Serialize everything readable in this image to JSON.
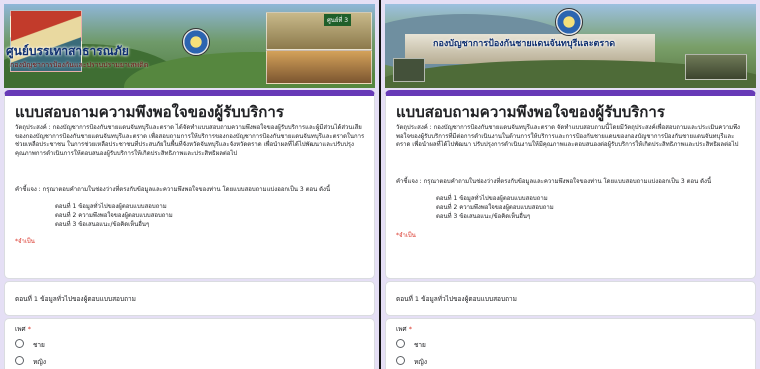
{
  "panels": [
    {
      "banner": {
        "title": "ศูนย์บรรเทาสาธารณภัย",
        "subtitle": "กองบัญชาการป้องกันและปราบปรามยาเสพติด",
        "tag": "ศูนย์ที่ 3"
      },
      "form": {
        "title": "แบบสอบถามความพึงพอใจของผู้รับบริการ",
        "objective": "วัตถุประสงค์ : กองบัญชาการป้องกันชายแดนจันทบุรีและตราด ได้จัดทำแบบสอบถามความพึงพอใจของผู้รับบริการและผู้มีส่วนได้ส่วนเสียของกองบัญชาการป้องกันชายแดนจันทบุรีและตราด เพื่อสอบถามการให้บริการของกองบัญชาการป้องกันชายแดนจันทบุรีและตราดในการช่วยเหลือประชาชน ในการช่วยเหลือประชาชนที่ประสบภัยในพื้นที่จังหวัดจันทบุรีและจังหวัดตราด เพื่อนำผลที่ได้ไปพัฒนาและปรับปรุงคุณภาพการดำเนินการให้ตอบสนองผู้รับบริการให้เกิดประสิทธิภาพและประสิทธิผลต่อไป",
        "explanation": "คำชี้แจง : กรุณาตอบคำถามในช่องว่างที่ตรงกับข้อมูลและความพึงพอใจของท่าน โดยแบบสอบถามแบ่งออกเป็น 3 ตอน ดังนี้",
        "parts": [
          "ตอนที่ 1 ข้อมูลทั่วไปของผู้ตอบแบบสอบถาม",
          "ตอนที่ 2 ความพึงพอใจของผู้ตอบแบบสอบถาม",
          "ตอนที่ 3 ข้อเสนอแนะ/ข้อคิดเห็นอื่นๆ"
        ],
        "required_note": "*จำเป็น",
        "section_title": "ตอนที่ 1 ข้อมูลทั่วไปของผู้ตอบแบบสอบถาม",
        "question_label": "เพศ",
        "question_star": "*",
        "options": [
          "ชาย",
          "หญิง"
        ]
      }
    },
    {
      "banner": {
        "title": "กองบัญชาการป้องกันชายแดนจันทบุรีและตราด",
        "subtitle": "",
        "tag": ""
      },
      "form": {
        "title": "แบบสอบถามความพึงพอใจของผู้รับบริการ",
        "objective": "วัตถุประสงค์ : กองบัญชาการป้องกันชายแดนจันทบุรีและตราด จัดทำแบบสอบถามนี้โดยมีวัตถุประสงค์เพื่อสอบถามและประเมินความพึงพอใจของผู้รับบริการที่มีต่อการดำเนินงานในด้านการให้บริการและการป้องกันชายแดนของกองบัญชาการป้องกันชายแดนจันทบุรีและตราด เพื่อนำผลที่ได้ไปพัฒนา ปรับปรุงการดำเนินงานให้มีคุณภาพและตอบสนองต่อผู้รับบริการให้เกิดประสิทธิภาพและประสิทธิผลต่อไป",
        "explanation": "คำชี้แจง : กรุณาตอบคำถามในช่องว่างที่ตรงกับข้อมูลและความพึงพอใจของท่าน โดยแบบสอบถามแบ่งออกเป็น 3 ตอน ดังนี้",
        "parts": [
          "ตอนที่ 1 ข้อมูลทั่วไปของผู้ตอบแบบสอบถาม",
          "ตอนที่ 2 ความพึงพอใจของผู้ตอบแบบสอบถาม",
          "ตอนที่ 3 ข้อเสนอแนะ/ข้อคิดเห็นอื่นๆ"
        ],
        "required_note": "*จำเป็น",
        "section_title": "ตอนที่ 1 ข้อมูลทั่วไปของผู้ตอบแบบสอบถาม",
        "question_label": "เพศ",
        "question_star": "*",
        "options": [
          "ชาย",
          "หญิง"
        ]
      }
    }
  ],
  "colors": {
    "accent": "#673ab7",
    "page_bg": "#e5dff5",
    "required": "#d93025"
  }
}
